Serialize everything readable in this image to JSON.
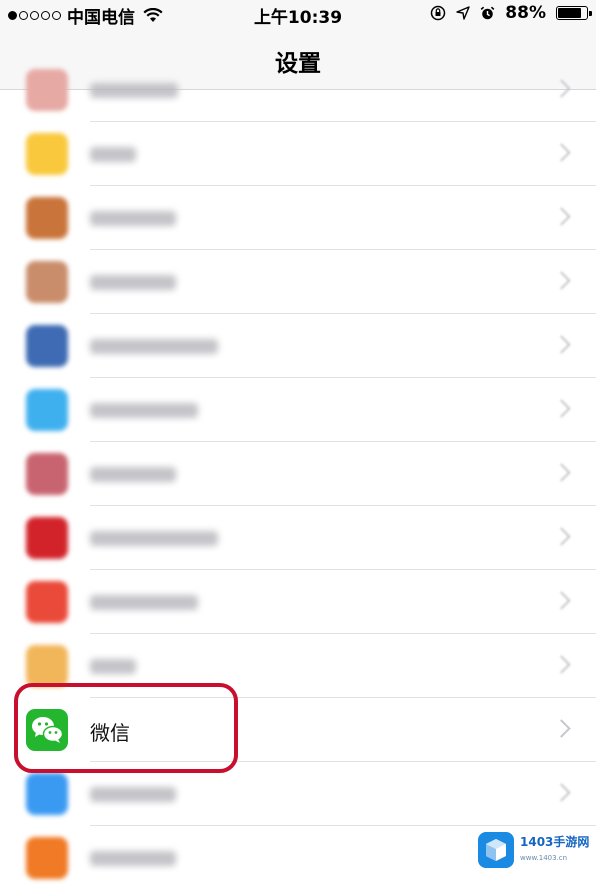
{
  "status_bar": {
    "carrier": "中国电信",
    "time": "上午10:39",
    "battery_percent": "88%",
    "battery_level": 0.88
  },
  "nav": {
    "title": "设置"
  },
  "rows": [
    {
      "id": "row-0",
      "label": null,
      "icon_color": "#e7a9a4"
    },
    {
      "id": "row-1",
      "label": null,
      "icon_color": "#f9c83c"
    },
    {
      "id": "row-2",
      "label": null,
      "icon_color": "#c9743a"
    },
    {
      "id": "row-3",
      "label": null,
      "icon_color": "#c98d6b"
    },
    {
      "id": "row-4",
      "label": null,
      "icon_color": "#3e6bb3"
    },
    {
      "id": "row-5",
      "label": null,
      "icon_color": "#3fb0ee"
    },
    {
      "id": "row-6",
      "label": null,
      "icon_color": "#c8646f"
    },
    {
      "id": "row-7",
      "label": null,
      "icon_color": "#d2232a"
    },
    {
      "id": "row-8",
      "label": null,
      "icon_color": "#ea4a3a"
    },
    {
      "id": "row-9",
      "label": null,
      "icon_color": "#f2b65a"
    },
    {
      "id": "row-10",
      "label": "微信",
      "icon_color": "#23b62e",
      "highlighted": true
    },
    {
      "id": "row-11",
      "label": null,
      "icon_color": "#3a9af2"
    },
    {
      "id": "row-12",
      "label": null,
      "icon_color": "#f07a25"
    }
  ],
  "watermark": {
    "text": "1403手游网",
    "sub": "www.1403.cn",
    "color": "#1a8ae2"
  }
}
